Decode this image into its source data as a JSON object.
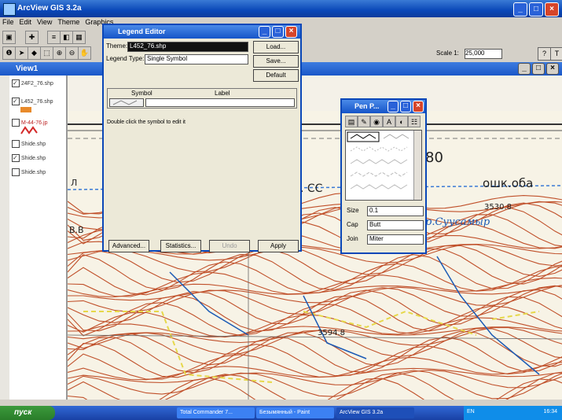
{
  "app": {
    "title": "ArcView GIS 3.2a"
  },
  "menu": [
    "File",
    "Edit",
    "View",
    "Theme",
    "Graphics"
  ],
  "view_title": "View1",
  "scale": {
    "label": "Scale 1:",
    "value": "25,000"
  },
  "toc": {
    "items": [
      {
        "label": "24F2_76.shp",
        "checked": true
      },
      {
        "label": "L452_76.shp",
        "checked": true
      },
      {
        "label": "M-44-76.jp",
        "checked": false
      },
      {
        "label": "Shide.shp",
        "checked": false
      },
      {
        "label": "Shide.shp",
        "checked": true
      },
      {
        "label": "Shide.shp",
        "checked": false
      }
    ]
  },
  "legend_editor": {
    "title": "Legend Editor",
    "theme_label": "Theme:",
    "theme_value": "L452_76.shp",
    "legend_type_label": "Legend Type:",
    "legend_type_value": "Single Symbol",
    "load_button": "Load...",
    "save_button": "Save...",
    "default_button": "Default",
    "col_symbol": "Symbol",
    "col_label": "Label",
    "hint": "Double click the symbol to edit it",
    "advanced_button": "Advanced...",
    "statistics_button": "Statistics...",
    "undo_button": "Undo",
    "apply_button": "Apply"
  },
  "pen_palette": {
    "title": "Pen P...",
    "size_label": "Size",
    "size_value": "0.1",
    "cap_label": "Cap",
    "cap_value": "Butt",
    "join_label": "Join",
    "join_value": "Miter"
  },
  "map": {
    "labels": [
      "80",
      "ошк.оба",
      ". CC",
      "р.Суусамыр",
      "3530.8",
      "3594.8",
      "B.B",
      "Л"
    ]
  },
  "taskbar": {
    "start": "пуск",
    "tasks": [
      "Total Commander 7...",
      "Безымянный - Paint",
      "ArcView GIS 3.2a"
    ],
    "lang": "EN",
    "clock": "16:34"
  },
  "colors": {
    "titlebar": "#0a47b8",
    "contour": "#c0502a",
    "road": "#e6d84a",
    "river": "#1c5bb5"
  }
}
